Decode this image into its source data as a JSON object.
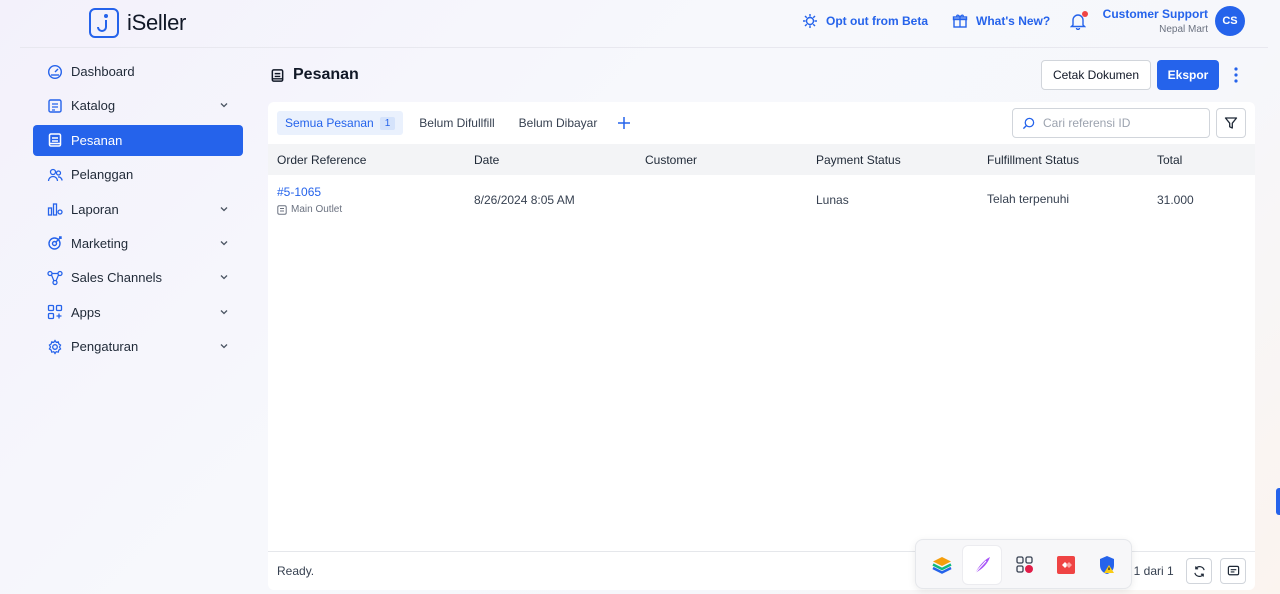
{
  "colors": {
    "accent": "#2563eb",
    "alert": "#ef4444"
  },
  "header": {
    "brand": "iSeller",
    "beta_link": "Opt out from Beta",
    "whats_new": "What's New?",
    "support_name": "Customer Support",
    "store_name": "Nepal Mart",
    "avatar_initials": "CS"
  },
  "sidebar": {
    "items": [
      {
        "label": "Dashboard",
        "icon": "dashboard-icon"
      },
      {
        "label": "Katalog",
        "icon": "catalog-icon"
      },
      {
        "label": "Pesanan",
        "icon": "orders-icon"
      },
      {
        "label": "Pelanggan",
        "icon": "customers-icon"
      },
      {
        "label": "Laporan",
        "icon": "reports-icon"
      },
      {
        "label": "Marketing",
        "icon": "marketing-icon"
      },
      {
        "label": "Sales Channels",
        "icon": "channels-icon"
      },
      {
        "label": "Apps",
        "icon": "apps-icon"
      },
      {
        "label": "Pengaturan",
        "icon": "settings-icon"
      }
    ]
  },
  "page": {
    "title": "Pesanan",
    "print_button": "Cetak Dokumen",
    "export_button": "Ekspor"
  },
  "tabs": [
    {
      "label": "Semua Pesanan",
      "count": "1"
    },
    {
      "label": "Belum Difullfill"
    },
    {
      "label": "Belum Dibayar"
    }
  ],
  "search": {
    "placeholder": "Cari referensi ID"
  },
  "table": {
    "columns": [
      "Order Reference",
      "Date",
      "Customer",
      "Payment Status",
      "Fulfillment Status",
      "Total"
    ],
    "rows": [
      {
        "reference": "#5-1065",
        "outlet": "Main Outlet",
        "date": "8/26/2024 8:05 AM",
        "customer": "",
        "payment": "Lunas",
        "fulfillment": "Telah terpenuhi",
        "total": "31.000"
      }
    ]
  },
  "footer": {
    "status": "Ready.",
    "pagination": "t 1 dari 1"
  }
}
